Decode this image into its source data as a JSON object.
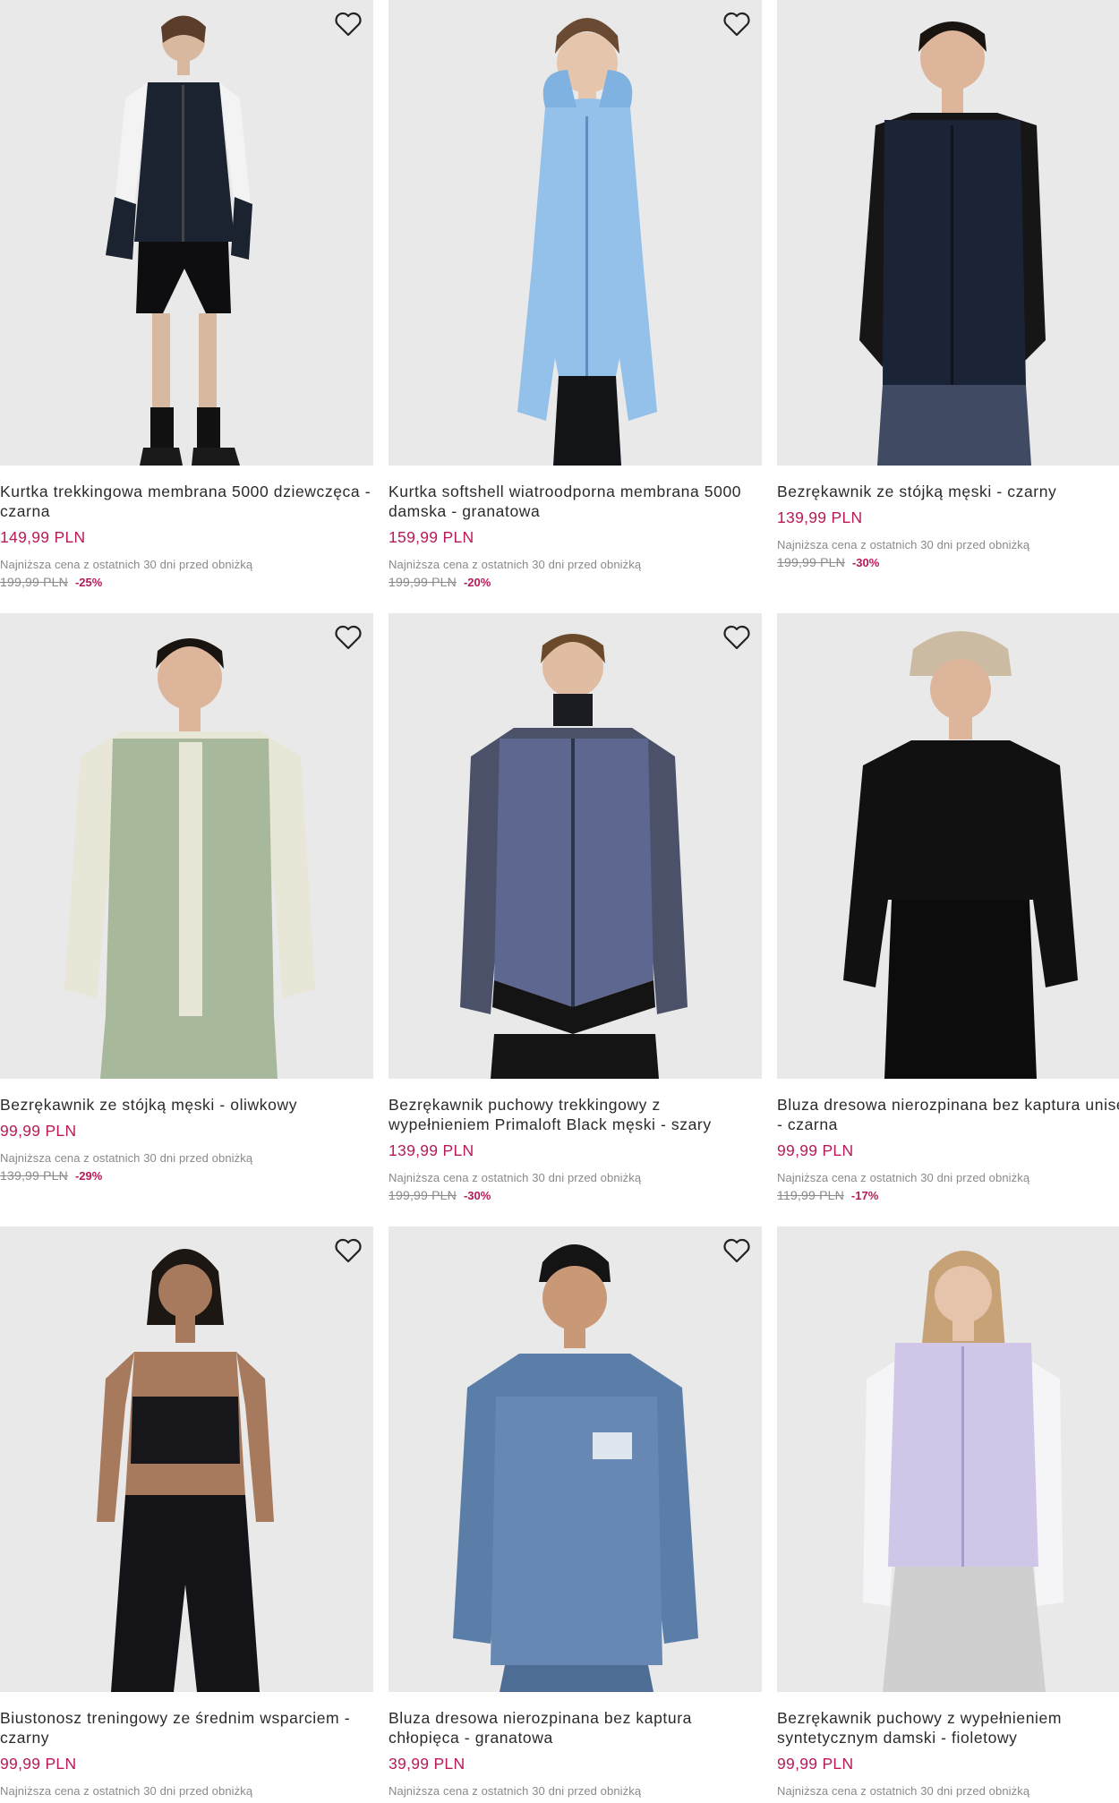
{
  "colors": {
    "price": "#b8195a",
    "muted": "#8a8a8a",
    "image_bg": "#e9e9e9"
  },
  "wishlist_icon": "heart-outline-icon",
  "products": [
    {
      "name": "Kurtka trekkingowa membrana 5000 dziewczęca - czarna",
      "price": "149,99 PLN",
      "lowest_label": "Najniższa cena z ostatnich 30 dni przed obniżką",
      "old_price": "199,99 PLN",
      "discount": "-25%"
    },
    {
      "name": "Kurtka softshell wiatroodporna membrana 5000 damska - granatowa",
      "price": "159,99 PLN",
      "lowest_label": "Najniższa cena z ostatnich 30 dni przed obniżką",
      "old_price": "199,99 PLN",
      "discount": "-20%"
    },
    {
      "name": "Bezrękawnik ze stójką męski - czarny",
      "price": "139,99 PLN",
      "lowest_label": "Najniższa cena z ostatnich 30 dni przed obniżką",
      "old_price": "199,99 PLN",
      "discount": "-30%"
    },
    {
      "name": "Bezrękawnik ze stójką męski - oliwkowy",
      "price": "99,99 PLN",
      "lowest_label": "Najniższa cena z ostatnich 30 dni przed obniżką",
      "old_price": "139,99 PLN",
      "discount": "-29%"
    },
    {
      "name": "Bezrękawnik puchowy trekkingowy z wypełnieniem Primaloft Black męski - szary",
      "price": "139,99 PLN",
      "lowest_label": "Najniższa cena z ostatnich 30 dni przed obniżką",
      "old_price": "199,99 PLN",
      "discount": "-30%"
    },
    {
      "name": "Bluza dresowa nierozpinana bez kaptura uniseks - czarna",
      "price": "99,99 PLN",
      "lowest_label": "Najniższa cena z ostatnich 30 dni przed obniżką",
      "old_price": "119,99 PLN",
      "discount": "-17%"
    },
    {
      "name": "Biustonosz treningowy ze średnim wsparciem - czarny",
      "price": "99,99 PLN",
      "lowest_label": "Najniższa cena z ostatnich 30 dni przed obniżką",
      "old_price": "",
      "discount": ""
    },
    {
      "name": "Bluza dresowa nierozpinana bez kaptura chłopięca - granatowa",
      "price": "39,99 PLN",
      "lowest_label": "Najniższa cena z ostatnich 30 dni przed obniżką",
      "old_price": "",
      "discount": ""
    },
    {
      "name": "Bezrękawnik puchowy z wypełnieniem syntetycznym damski - fioletowy",
      "price": "99,99 PLN",
      "lowest_label": "Najniższa cena z ostatnich 30 dni przed obniżką",
      "old_price": "",
      "discount": ""
    }
  ]
}
